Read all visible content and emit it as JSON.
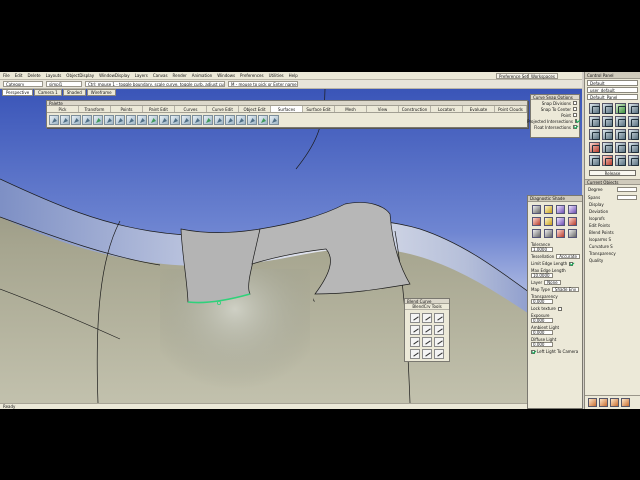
{
  "menu": {
    "items": [
      "File",
      "Edit",
      "Delete",
      "Layouts",
      "ObjectDisplay",
      "WindowDisplay",
      "Layers",
      "Canvas",
      "Render",
      "Animation",
      "Windows",
      "Preferences",
      "Utilities",
      "Help"
    ],
    "preference_sets": "Preference Sets",
    "workspaces": "Workspaces",
    "control_panel": "Control Panel"
  },
  "toolrow": {
    "category_label": "Category",
    "field1": "simpl1",
    "hint": "Ctrl: mouse 1 - toggle boundary, scale curve, toggle curb, adjust curvature",
    "hint2": "M - mouse to pick or Enter name",
    "mode": "Default Layer",
    "layer": "Layer"
  },
  "viewport": {
    "tabs": [
      "Perspective",
      "Camera 1",
      "Shaded",
      "Wireframe"
    ],
    "status": "Ready"
  },
  "palette": {
    "title": "Palette",
    "tabs": [
      "Pick",
      "Transform",
      "Points",
      "Paint Edit",
      "Curves",
      "Curve Edit",
      "Object Edit",
      "Surfaces",
      "Surface Edit",
      "Mesh",
      "View",
      "Construction",
      "Locators",
      "Evaluate",
      "Point Clouds"
    ],
    "active_tab": "Surfaces"
  },
  "snap_options": {
    "title": "Curve Snap Options",
    "rows": [
      {
        "label": "Snap Divisions",
        "checked": false
      },
      {
        "label": "Snap To Center",
        "checked": false
      },
      {
        "label": "Point",
        "checked": false
      },
      {
        "label": "Projected Intersections",
        "checked": true
      },
      {
        "label": "Float Intersections",
        "checked": true
      }
    ]
  },
  "blend_curve": {
    "title": "Blend Curve",
    "subtitle": "BlendCrv Tools"
  },
  "control_panel": {
    "title": "Control Panel",
    "preset": "Default",
    "user": "user_default",
    "panel": "Default_Panel",
    "release": "Release",
    "sections": {
      "shelf": "Shelf",
      "properties": "Current Objects"
    },
    "display_label": "Display",
    "display_fields": [
      {
        "label": "Degree"
      },
      {
        "label": "Spans"
      }
    ],
    "tree": [
      "Display",
      "Deviation",
      "Isoprofs",
      "Edit Points",
      "Blend Points",
      "Isoparms S",
      "Curvature S",
      "Transparency",
      "Quality"
    ]
  },
  "shader": {
    "title": "Diagnostic Shade",
    "tolerance_label": "Tolerance",
    "tolerance_value": "1.0000",
    "tessellation_label": "Tessellation",
    "tessellation_value": "Accurate",
    "limit_edge_label": "Limit Edge Length",
    "max_edge_label": "Max Edge Length",
    "max_edge_value": "10.0000",
    "layer_label": "Layer",
    "layer_value": "None",
    "map_type_label": "Map Type",
    "map_type_value": "Shade Env",
    "transparency_label": "Transparency",
    "transparency_value": "0.000",
    "lock_texture_label": "Lock texture",
    "exposure_label": "Exposure",
    "exposure_value": "0.000",
    "ambient_label": "Ambient Light",
    "ambient_value": "0.000",
    "diffuse_label": "Diffuse Light",
    "diffuse_value": "0.000",
    "left_light_label": "Left Light To Camera"
  }
}
